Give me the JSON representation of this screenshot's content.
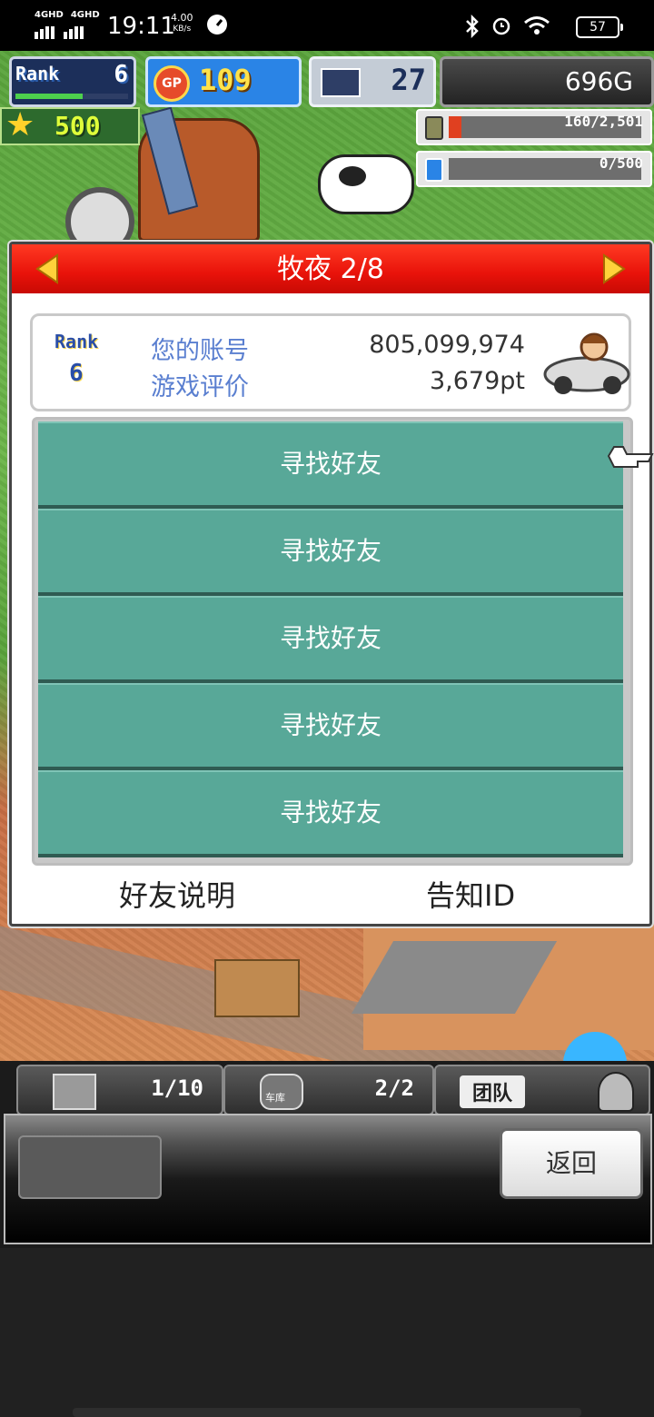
{
  "status_bar": {
    "network_1": "4GHD",
    "network_2": "4GHD",
    "time": "19:11",
    "speed_value": "4.00",
    "speed_unit": "KB/s",
    "battery": "57",
    "icons": [
      "speedometer-icon",
      "bluetooth-icon",
      "alarm-icon",
      "wifi-icon",
      "battery-icon"
    ]
  },
  "hud": {
    "rank_label": "Rank",
    "rank_value": "6",
    "rank_progress": 0.6,
    "gp_label": "GP",
    "gp_value": "109",
    "pc_value": "27",
    "money": "696G",
    "star_value": "500",
    "resource_1": {
      "value": "160/2,501",
      "fill": 0.064,
      "icon": "fuel-can-icon"
    },
    "resource_2": {
      "value": "0/500",
      "fill": 0.0,
      "icon": "bottle-icon"
    }
  },
  "dialog": {
    "title": "牧夜 2/8",
    "profile": {
      "rank_label": "Rank",
      "rank_value": "6",
      "account_label": "您的账号",
      "account_value": "805,099,974",
      "rating_label": "游戏评价",
      "rating_value": "3,679pt"
    },
    "friend_rows": [
      "寻找好友",
      "寻找好友",
      "寻找好友",
      "寻找好友",
      "寻找好友"
    ],
    "footer_left": "好友说明",
    "footer_right": "告知ID"
  },
  "bottom": {
    "tab1_value": "1/10",
    "tab2_label": "车库",
    "tab2_value": "2/2",
    "tab3_label": "团队",
    "back_label": "返回"
  },
  "colors": {
    "header_red": "#e8120a",
    "row_teal": "#58a898",
    "link_blue": "#5a7fd0"
  }
}
